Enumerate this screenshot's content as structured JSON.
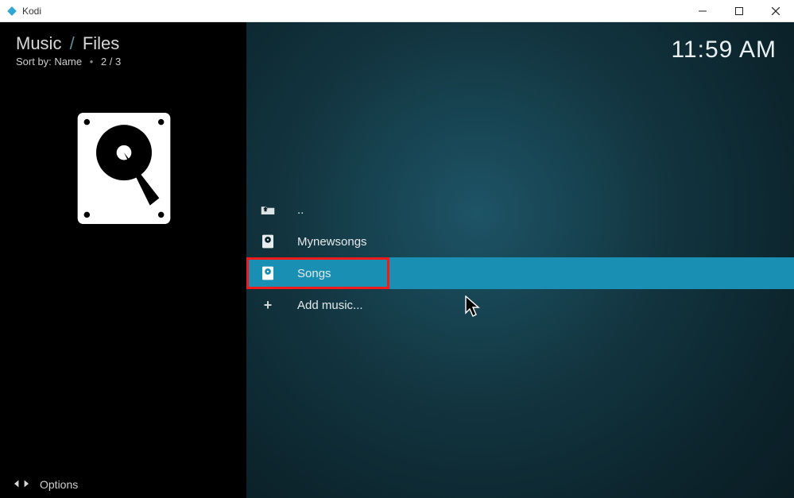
{
  "window": {
    "title": "Kodi"
  },
  "breadcrumb": {
    "section": "Music",
    "sub": "Files"
  },
  "sort": {
    "label": "Sort by:",
    "value": "Name",
    "position": "2 / 3"
  },
  "clock": "11:59 AM",
  "rows": {
    "up": {
      "label": ".."
    },
    "r1": {
      "label": "Mynewsongs"
    },
    "r2": {
      "label": "Songs"
    },
    "add": {
      "label": "Add music..."
    }
  },
  "options": {
    "label": "Options"
  }
}
